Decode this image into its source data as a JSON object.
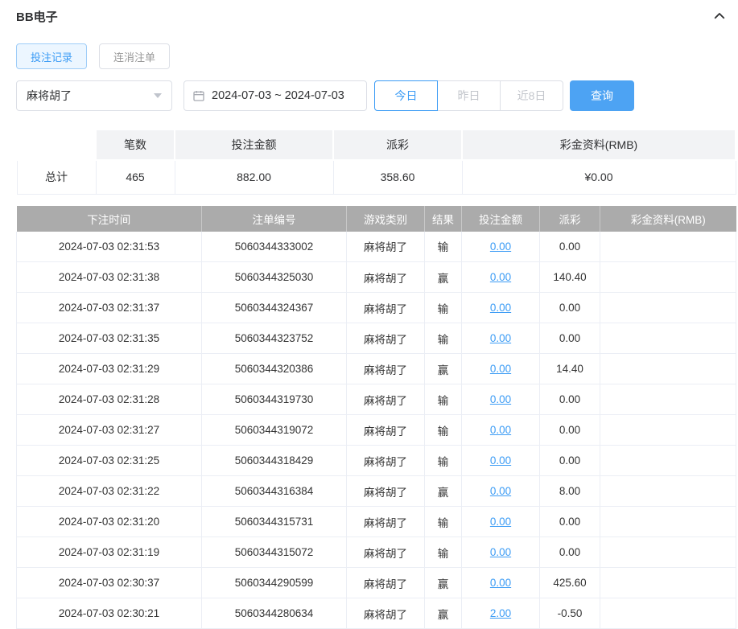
{
  "header": {
    "title": "BB电子"
  },
  "icons": {
    "collapse": "chevron-up-icon",
    "calendar": "calendar-icon",
    "select_caret": "caret-down-icon"
  },
  "colors": {
    "accent": "#4da3f3",
    "link": "#3c9cf5",
    "negative": "#f25f5f",
    "table_header_bg": "#ababab"
  },
  "tabs": [
    {
      "label": "投注记录",
      "active": true
    },
    {
      "label": "连消注单",
      "active": false
    }
  ],
  "filters": {
    "game_select": {
      "value": "麻将胡了"
    },
    "date_range": "2024-07-03 ~ 2024-07-03",
    "quick_buttons": [
      {
        "label": "今日",
        "active": true
      },
      {
        "label": "昨日",
        "active": false
      },
      {
        "label": "近8日",
        "active": false
      }
    ],
    "search_label": "查询"
  },
  "summary": {
    "columns": [
      "",
      "笔数",
      "投注金额",
      "派彩",
      "彩金资料(RMB)"
    ],
    "row_label": "总计",
    "count": "465",
    "bet_amount": "882.00",
    "payout": "358.60",
    "bonus": "¥0.00"
  },
  "table": {
    "columns": [
      "下注时间",
      "注单编号",
      "游戏类别",
      "结果",
      "投注金额",
      "派彩",
      "彩金资料(RMB)"
    ],
    "rows": [
      {
        "time": "2024-07-03 02:31:53",
        "order": "5060344333002",
        "game": "麻将胡了",
        "result": "输",
        "bet": "0.00",
        "payout": "0.00",
        "bonus": "",
        "negative": false
      },
      {
        "time": "2024-07-03 02:31:38",
        "order": "5060344325030",
        "game": "麻将胡了",
        "result": "赢",
        "bet": "0.00",
        "payout": "140.40",
        "bonus": "",
        "negative": false
      },
      {
        "time": "2024-07-03 02:31:37",
        "order": "5060344324367",
        "game": "麻将胡了",
        "result": "输",
        "bet": "0.00",
        "payout": "0.00",
        "bonus": "",
        "negative": false
      },
      {
        "time": "2024-07-03 02:31:35",
        "order": "5060344323752",
        "game": "麻将胡了",
        "result": "输",
        "bet": "0.00",
        "payout": "0.00",
        "bonus": "",
        "negative": false
      },
      {
        "time": "2024-07-03 02:31:29",
        "order": "5060344320386",
        "game": "麻将胡了",
        "result": "赢",
        "bet": "0.00",
        "payout": "14.40",
        "bonus": "",
        "negative": false
      },
      {
        "time": "2024-07-03 02:31:28",
        "order": "5060344319730",
        "game": "麻将胡了",
        "result": "输",
        "bet": "0.00",
        "payout": "0.00",
        "bonus": "",
        "negative": false
      },
      {
        "time": "2024-07-03 02:31:27",
        "order": "5060344319072",
        "game": "麻将胡了",
        "result": "输",
        "bet": "0.00",
        "payout": "0.00",
        "bonus": "",
        "negative": false
      },
      {
        "time": "2024-07-03 02:31:25",
        "order": "5060344318429",
        "game": "麻将胡了",
        "result": "输",
        "bet": "0.00",
        "payout": "0.00",
        "bonus": "",
        "negative": false
      },
      {
        "time": "2024-07-03 02:31:22",
        "order": "5060344316384",
        "game": "麻将胡了",
        "result": "赢",
        "bet": "0.00",
        "payout": "8.00",
        "bonus": "",
        "negative": false
      },
      {
        "time": "2024-07-03 02:31:20",
        "order": "5060344315731",
        "game": "麻将胡了",
        "result": "输",
        "bet": "0.00",
        "payout": "0.00",
        "bonus": "",
        "negative": false
      },
      {
        "time": "2024-07-03 02:31:19",
        "order": "5060344315072",
        "game": "麻将胡了",
        "result": "输",
        "bet": "0.00",
        "payout": "0.00",
        "bonus": "",
        "negative": false
      },
      {
        "time": "2024-07-03 02:30:37",
        "order": "5060344290599",
        "game": "麻将胡了",
        "result": "赢",
        "bet": "0.00",
        "payout": "425.60",
        "bonus": "",
        "negative": false
      },
      {
        "time": "2024-07-03 02:30:21",
        "order": "5060344280634",
        "game": "麻将胡了",
        "result": "赢",
        "bet": "2.00",
        "payout": "-0.50",
        "bonus": "",
        "negative": true
      }
    ]
  }
}
